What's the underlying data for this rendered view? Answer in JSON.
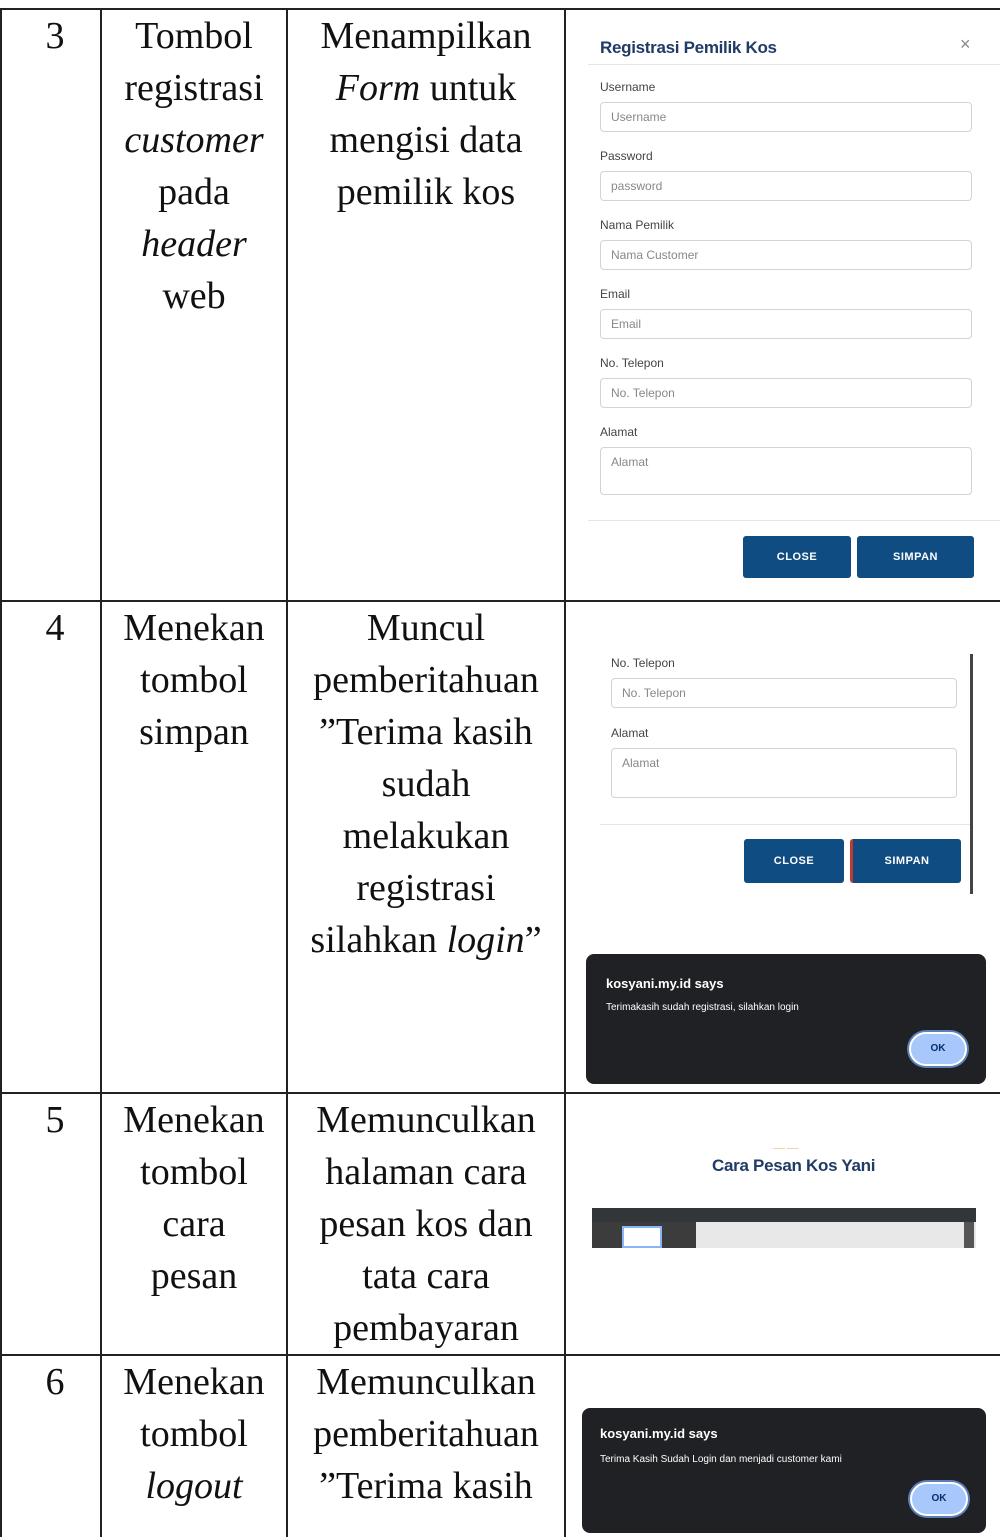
{
  "table": {
    "rows": [
      {
        "no": "3",
        "action": [
          "Tombol",
          "registrasi",
          "customer",
          "pada",
          "header",
          "web"
        ],
        "result": [
          "Menampilkan",
          "Form untuk",
          "mengisi data",
          "pemilik kos"
        ]
      },
      {
        "no": "4",
        "action": [
          "Menekan",
          "tombol",
          "simpan"
        ],
        "result": [
          "Muncul",
          "pemberitahuan",
          "”Terima kasih",
          "sudah",
          "melakukan",
          "registrasi",
          "silahkan login”"
        ]
      },
      {
        "no": "5",
        "action": [
          "Menekan",
          "tombol",
          "cara",
          "pesan"
        ],
        "result": [
          "Memunculkan",
          "halaman cara",
          "pesan kos dan",
          "tata cara",
          "pembayaran"
        ]
      },
      {
        "no": "6",
        "action": [
          "Menekan",
          "tombol",
          "logout"
        ],
        "result": [
          "Memunculkan",
          "pemberitahuan",
          "”Terima kasih"
        ]
      }
    ]
  },
  "registration_modal": {
    "title": "Registrasi Pemilik Kos",
    "close_glyph": "×",
    "fields": [
      {
        "label": "Username",
        "placeholder": "Username"
      },
      {
        "label": "Password",
        "placeholder": "password"
      },
      {
        "label": "Nama Pemilik",
        "placeholder": "Nama Customer"
      },
      {
        "label": "Email",
        "placeholder": "Email"
      },
      {
        "label": "No. Telepon",
        "placeholder": "No. Telepon"
      },
      {
        "label": "Alamat",
        "placeholder": "Alamat"
      }
    ],
    "close_label": "CLOSE",
    "save_label": "SIMPAN"
  },
  "save_screen": {
    "fields": [
      {
        "label": "No. Telepon",
        "placeholder": "No. Telepon"
      },
      {
        "label": "Alamat",
        "placeholder": "Alamat"
      }
    ],
    "close_label": "CLOSE",
    "save_label": "SIMPAN",
    "alert": {
      "title": "kosyani.my.id says",
      "message": "Terimakasih sudah registrasi, silahkan login",
      "ok_label": "OK"
    }
  },
  "cara_pesan": {
    "title": "Cara Pesan Kos Yani"
  },
  "logout_alert": {
    "title": "kosyani.my.id says",
    "message": "Terima Kasih Sudah Login dan menjadi customer kami",
    "ok_label": "OK"
  }
}
